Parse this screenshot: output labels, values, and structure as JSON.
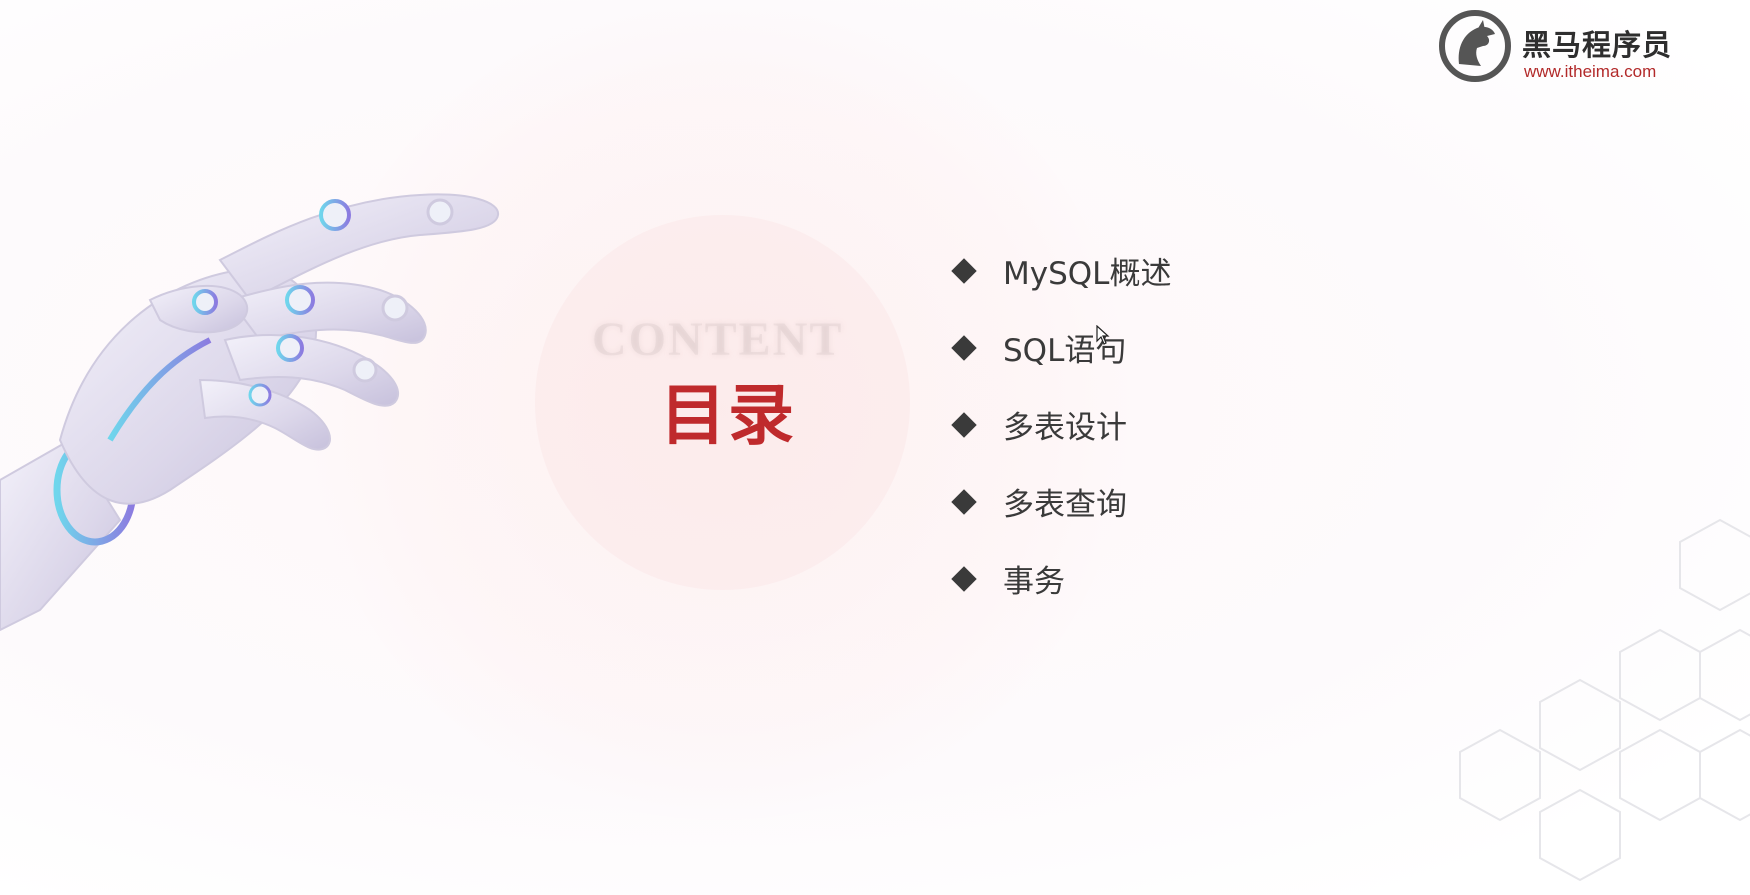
{
  "slide": {
    "watermark": "CONTENT",
    "title": "目录",
    "items": [
      {
        "label": "MySQL概述"
      },
      {
        "label": "SQL语句"
      },
      {
        "label": "多表设计"
      },
      {
        "label": "多表查询"
      },
      {
        "label": "事务"
      }
    ]
  },
  "logo": {
    "name": "黑马程序员",
    "url": "www.itheima.com",
    "icon": "horse-head-icon"
  },
  "colors": {
    "title": "#bf2a2c",
    "text": "#3a3a3a",
    "url": "#b22a2a"
  }
}
